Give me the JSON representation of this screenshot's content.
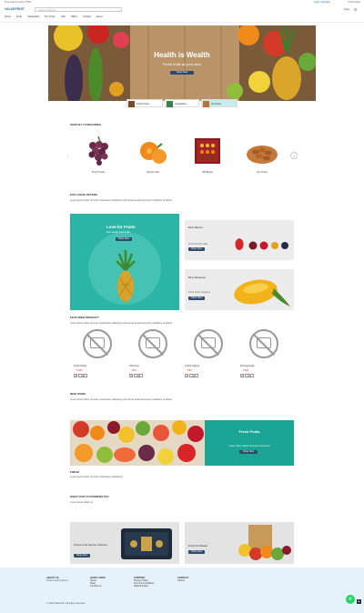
{
  "topbar": {
    "left_text": "Free delivery above ₹500",
    "right_text": "Login / Register",
    "right_text2": "Track Order"
  },
  "header": {
    "logo": "VALUEFRUIT",
    "search_placeholder": "Search products...",
    "cart_label": "Cart",
    "nav": [
      "Home",
      "Fruits",
      "Vegetables",
      "Dry Fruits",
      "Gifts",
      "Offers",
      "Contact",
      "About"
    ]
  },
  "hero": {
    "title": "Health is Wealth",
    "subtitle": "Fresh fruits at your door",
    "button": "Shop Now"
  },
  "hero_tabs": [
    {
      "label": "Fresh Fruits"
    },
    {
      "label": "Vegetables"
    },
    {
      "label": "Dry Fruits"
    }
  ],
  "categories": {
    "title": "SHOP BY CATEGORIES",
    "items": [
      {
        "label": "Fresh Fruits"
      },
      {
        "label": "Citrus Fruits"
      },
      {
        "label": "Gift Boxes"
      },
      {
        "label": "Dry Fruits"
      }
    ]
  },
  "exclusive": {
    "title": "EXCLUSIVE OFFERS",
    "desc": "Lorem ipsum dolor sit amet consectetur adipiscing elit sed do eiusmod tempor incididunt ut labore"
  },
  "promo_main": {
    "title": "Love for Fruits",
    "subtitle": "Best quality fresh fruits",
    "button": "Shop Now"
  },
  "promo_berries": {
    "title": "Best Berries",
    "subtitle": "Fresh berries daily",
    "button": "Shop Now"
  },
  "promo_mango": {
    "title": "Best Mangoes",
    "subtitle": "Farm fresh mangoes",
    "button": "Shop Now"
  },
  "featured": {
    "title": "FEATURED PRODUCT",
    "desc": "Lorem ipsum dolor sit amet consectetur adipiscing elit sed do eiusmod tempor incididunt ut labore",
    "items": [
      {
        "name": "Fresh Apple",
        "price": "₹120",
        "qty": "1",
        "cta": "Add"
      },
      {
        "name": "Kiwi Fruit",
        "price": "₹90",
        "qty": "1",
        "cta": "Add"
      },
      {
        "name": "Green Grapes",
        "price": "₹80",
        "qty": "1",
        "cta": "Add"
      },
      {
        "name": "Pomegranate",
        "price": "₹150",
        "qty": "1",
        "cta": "Add"
      }
    ]
  },
  "new_items": {
    "title": "NEW ITEMS",
    "desc": "Lorem ipsum dolor sit amet consectetur adipiscing elit sed do eiusmod tempor incididunt ut labore"
  },
  "banner": {
    "title": "Fresh Fruits",
    "subtitle": "Lorem ipsum dolor sit amet consectetur",
    "button": "Shop Now",
    "caption": "FRESH",
    "caption_desc": "Lorem ipsum dolor sit amet consectetur adipiscing"
  },
  "testimonial": {
    "title": "WHAT OUR CUSTOMERS SAY",
    "desc": "Lorem ipsum dolor sit"
  },
  "offers_bottom": [
    {
      "text": "Premium Gift Hamper Collection",
      "button": "Shop Now"
    },
    {
      "text": "Fresh Fruit Basket",
      "button": "Shop Now"
    }
  ],
  "footer": {
    "cols": [
      {
        "title": "ABOUT US",
        "links": [
          "Fresh Fruits Delivery"
        ]
      },
      {
        "title": "QUICK LINKS",
        "links": [
          "Home",
          "Shop",
          "Contact us"
        ]
      },
      {
        "title": "SUPPORT",
        "links": [
          "Privacy Policy",
          "Terms & Conditions",
          "Refund Policy"
        ]
      },
      {
        "title": "CONTACT",
        "links": [
          "Call us"
        ]
      }
    ],
    "copyright": "© 2024 Valuefruit. All rights reserved."
  },
  "colors": {
    "teal": "#1aa595",
    "navy": "#2f4b6c",
    "footer_bg": "#e6f2fb",
    "accent_red": "#c0392b"
  }
}
